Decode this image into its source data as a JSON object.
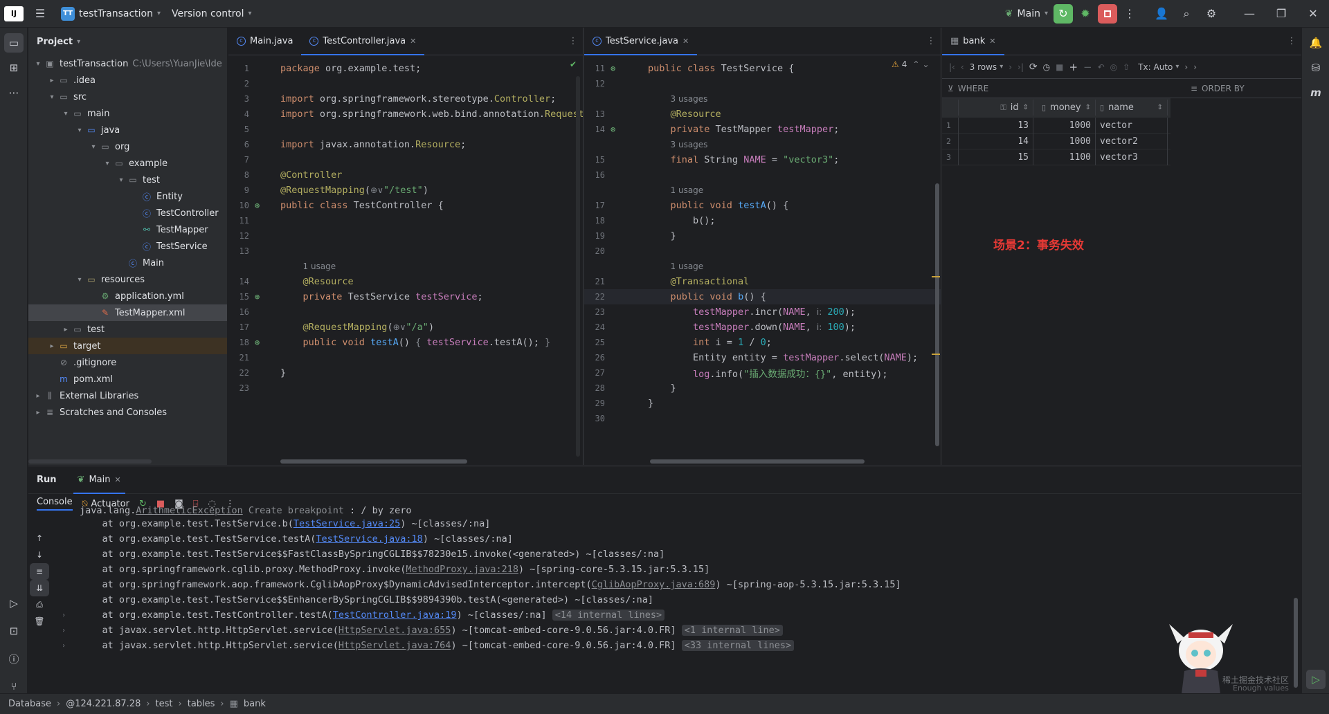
{
  "titlebar": {
    "project_badge": "TT",
    "project_name": "testTransaction",
    "vcs": "Version control",
    "run_config": "Main"
  },
  "project_panel": {
    "title": "Project",
    "tree": [
      {
        "label": "testTransaction",
        "extra": "C:\\Users\\YuanJie\\Ide",
        "depth": 0,
        "arrow": "▾",
        "icon": "module-icon"
      },
      {
        "label": ".idea",
        "depth": 1,
        "arrow": "▸",
        "icon": "folder-icon"
      },
      {
        "label": "src",
        "depth": 1,
        "arrow": "▾",
        "icon": "folder-icon"
      },
      {
        "label": "main",
        "depth": 2,
        "arrow": "▾",
        "icon": "folder-icon"
      },
      {
        "label": "java",
        "depth": 3,
        "arrow": "▾",
        "icon": "source-folder-icon"
      },
      {
        "label": "org",
        "depth": 4,
        "arrow": "▾",
        "icon": "package-icon"
      },
      {
        "label": "example",
        "depth": 5,
        "arrow": "▾",
        "icon": "package-icon"
      },
      {
        "label": "test",
        "depth": 6,
        "arrow": "▾",
        "icon": "package-icon"
      },
      {
        "label": "Entity",
        "depth": 7,
        "arrow": "",
        "icon": "class-icon"
      },
      {
        "label": "TestController",
        "depth": 7,
        "arrow": "",
        "icon": "class-icon"
      },
      {
        "label": "TestMapper",
        "depth": 7,
        "arrow": "",
        "icon": "mapper-icon"
      },
      {
        "label": "TestService",
        "depth": 7,
        "arrow": "",
        "icon": "class-icon"
      },
      {
        "label": "Main",
        "depth": 6,
        "arrow": "",
        "icon": "main-class-icon"
      },
      {
        "label": "resources",
        "depth": 3,
        "arrow": "▾",
        "icon": "resources-folder-icon"
      },
      {
        "label": "application.yml",
        "depth": 4,
        "arrow": "",
        "icon": "yml-icon"
      },
      {
        "label": "TestMapper.xml",
        "depth": 4,
        "arrow": "",
        "icon": "xml-icon",
        "selected": true
      },
      {
        "label": "test",
        "depth": 2,
        "arrow": "▸",
        "icon": "folder-icon"
      },
      {
        "label": "target",
        "depth": 1,
        "arrow": "▸",
        "icon": "folder-orange-icon",
        "highlight": true
      },
      {
        "label": ".gitignore",
        "depth": 1,
        "arrow": "",
        "icon": "gitignore-icon"
      },
      {
        "label": "pom.xml",
        "depth": 1,
        "arrow": "",
        "icon": "maven-icon"
      },
      {
        "label": "External Libraries",
        "depth": 0,
        "arrow": "▸",
        "icon": "library-icon"
      },
      {
        "label": "Scratches and Consoles",
        "depth": 0,
        "arrow": "▸",
        "icon": "scratch-icon"
      }
    ]
  },
  "editor1": {
    "tabs": [
      {
        "label": "Main.java",
        "active": false
      },
      {
        "label": "TestController.java",
        "active": true
      }
    ],
    "lines": [
      {
        "n": "1",
        "html": "<span class='kw'>package</span> org.example.test;"
      },
      {
        "n": "2",
        "html": ""
      },
      {
        "n": "3",
        "html": "<span class='kw'>import</span> org.springframework.stereotype.<span class='an'>Controller</span>;"
      },
      {
        "n": "4",
        "html": "<span class='kw'>import</span> org.springframework.web.bind.annotation.<span class='an'>RequestM</span>"
      },
      {
        "n": "5",
        "html": ""
      },
      {
        "n": "6",
        "html": "<span class='kw'>import</span> javax.annotation.<span class='an'>Resource</span>;"
      },
      {
        "n": "7",
        "html": ""
      },
      {
        "n": "8",
        "html": "<span class='an'>@Controller</span>"
      },
      {
        "n": "9",
        "html": "<span class='an'>@RequestMapping</span>(<span class='hint'>⊕∨</span><span class='st'>\"/test\"</span>)"
      },
      {
        "n": "10",
        "html": "<span class='kw'>public class</span> TestController {"
      },
      {
        "n": "11",
        "html": ""
      },
      {
        "n": "12",
        "html": ""
      },
      {
        "n": "13",
        "html": ""
      },
      {
        "n": "",
        "html": "    <span class='hint'>1 usage</span>"
      },
      {
        "n": "14",
        "html": "    <span class='an'>@Resource</span>"
      },
      {
        "n": "15",
        "html": "    <span class='kw'>private</span> TestService <span class='fld'>testService</span>;"
      },
      {
        "n": "16",
        "html": ""
      },
      {
        "n": "17",
        "html": "    <span class='an'>@RequestMapping</span>(<span class='hint'>⊕∨</span><span class='st'>\"/a\"</span>)"
      },
      {
        "n": "18",
        "html": "    <span class='kw'>public void</span> <span class='fn'>testA</span>() <span class='cmt'>{</span> <span class='fld'>testService</span>.testA(); <span class='cmt'>}</span>"
      },
      {
        "n": "21",
        "html": ""
      },
      {
        "n": "22",
        "html": "}"
      },
      {
        "n": "23",
        "html": ""
      }
    ]
  },
  "editor2": {
    "tabs": [
      {
        "label": "TestService.java",
        "active": true
      }
    ],
    "warnings": "4",
    "lines": [
      {
        "n": "11",
        "html": "<span class='kw'>public class</span> TestService {"
      },
      {
        "n": "12",
        "html": ""
      },
      {
        "n": "",
        "html": "    <span class='hint'>3 usages</span>"
      },
      {
        "n": "13",
        "html": "    <span class='an'>@Resource</span>"
      },
      {
        "n": "14",
        "html": "    <span class='kw'>private</span> TestMapper <span class='fld'>testMapper</span>;"
      },
      {
        "n": "",
        "html": "    <span class='hint'>3 usages</span>"
      },
      {
        "n": "15",
        "html": "    <span class='kw'>final</span> String <span class='fld'>NAME</span> = <span class='st'>\"vector3\"</span>;"
      },
      {
        "n": "16",
        "html": ""
      },
      {
        "n": "",
        "html": "    <span class='hint'>1 usage</span>"
      },
      {
        "n": "17",
        "html": "    <span class='kw'>public void</span> <span class='fn'>testA</span>() {"
      },
      {
        "n": "18",
        "html": "        b();"
      },
      {
        "n": "19",
        "html": "    }"
      },
      {
        "n": "20",
        "html": ""
      },
      {
        "n": "",
        "html": "    <span class='hint'>1 usage</span>"
      },
      {
        "n": "21",
        "html": "    <span class='an'>@Transactional</span>"
      },
      {
        "n": "22",
        "html": "    <span class='kw'>public void</span> <span class='fn'>b</span>() {"
      },
      {
        "n": "23",
        "html": "        <span class='fld'>testMapper</span>.incr(<span class='fld'>NAME</span>, <span class='hint'>i:</span> <span class='num'>200</span>);"
      },
      {
        "n": "24",
        "html": "        <span class='fld'>testMapper</span>.down(<span class='fld'>NAME</span>, <span class='hint'>i:</span> <span class='num'>100</span>);"
      },
      {
        "n": "25",
        "html": "        <span class='kw'>int</span> i = <span class='num'>1</span> / <span class='num'>0</span>;"
      },
      {
        "n": "26",
        "html": "        Entity entity = <span class='fld'>testMapper</span>.select(<span class='fld'>NAME</span>);"
      },
      {
        "n": "27",
        "html": "        <span class='fld'>log</span>.info(<span class='st'>\"插入数据成功：{}\"</span>, entity);"
      },
      {
        "n": "28",
        "html": "    }"
      },
      {
        "n": "29",
        "html": "}"
      },
      {
        "n": "30",
        "html": ""
      }
    ]
  },
  "db_panel": {
    "tab": "bank",
    "rows_label": "3 rows",
    "tx_label": "Tx: Auto",
    "where": "WHERE",
    "order_by": "ORDER BY",
    "columns": [
      "id",
      "money",
      "name"
    ],
    "rows": [
      {
        "num": "1",
        "id": "13",
        "money": "1000",
        "name": "vector"
      },
      {
        "num": "2",
        "id": "14",
        "money": "1000",
        "name": "vector2"
      },
      {
        "num": "3",
        "id": "15",
        "money": "1100",
        "name": "vector3"
      }
    ],
    "annotation": "场景2：事务失效"
  },
  "run_panel": {
    "tab_run": "Run",
    "tab_main": "Main",
    "tab_console": "Console",
    "tab_actuator": "Actuator",
    "lines": [
      {
        "html": "java.lang.<span class='lnk2'>ArithmeticException</span> <span class='muted'>Create breakpoint</span> : / by zero",
        "cut": true
      },
      {
        "html": "    at org.example.test.TestService.b(<span class='lnk'>TestService.java:25</span>) ~[classes/:na]"
      },
      {
        "html": "    at org.example.test.TestService.testA(<span class='lnk'>TestService.java:18</span>) ~[classes/:na]"
      },
      {
        "html": "    at org.example.test.TestService$$FastClassBySpringCGLIB$$78230e15.invoke(&lt;generated&gt;) ~[classes/:na]"
      },
      {
        "html": "    at org.springframework.cglib.proxy.MethodProxy.invoke(<span class='lnk2'>MethodProxy.java:218</span>) ~[spring-core-5.3.15.jar:5.3.15]"
      },
      {
        "html": "    at org.springframework.aop.framework.CglibAopProxy$DynamicAdvisedInterceptor.intercept(<span class='lnk2'>CglibAopProxy.java:689</span>) ~[spring-aop-5.3.15.jar:5.3.15]"
      },
      {
        "html": "    at org.example.test.TestService$$EnhancerBySpringCGLIB$$9894390b.testA(&lt;generated&gt;) ~[classes/:na]"
      },
      {
        "html": "    at org.example.test.TestController.testA(<span class='lnk'>TestController.java:19</span>) ~[classes/:na] <span class='fold'>&lt;14 internal lines&gt;</span>",
        "fold": true
      },
      {
        "html": "    at javax.servlet.http.HttpServlet.service(<span class='lnk2'>HttpServlet.java:655</span>) ~[tomcat-embed-core-9.0.56.jar:4.0.FR] <span class='fold'>&lt;1 internal line&gt;</span>",
        "fold": true
      },
      {
        "html": "    at javax.servlet.http.HttpServlet.service(<span class='lnk2'>HttpServlet.java:764</span>) ~[tomcat-embed-core-9.0.56.jar:4.0.FR] <span class='fold'>&lt;33 internal lines&gt;</span>",
        "fold": true
      }
    ],
    "watermark": "稀土掘金技术社区",
    "hidden_text": "Enough values"
  },
  "statusbar": {
    "crumbs": [
      "Database",
      "@124.221.87.28",
      "test",
      "tables",
      "bank"
    ]
  },
  "colors": {
    "accent": "#3574f0",
    "run_green": "#5fb865",
    "stop_red": "#db5c5c",
    "annotation_red": "#e53935"
  }
}
